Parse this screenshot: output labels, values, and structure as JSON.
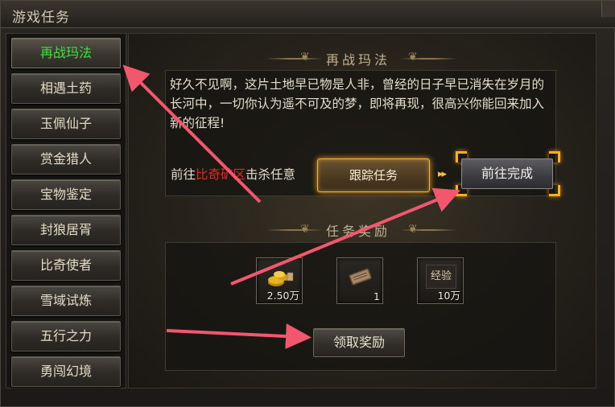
{
  "window": {
    "title": "游戏任务"
  },
  "sidebar": {
    "items": [
      {
        "label": "再战玛法",
        "active": true
      },
      {
        "label": "相遇土药"
      },
      {
        "label": "玉佩仙子"
      },
      {
        "label": "赏金猎人"
      },
      {
        "label": "宝物鉴定"
      },
      {
        "label": "封狼居胥"
      },
      {
        "label": "比奇使者"
      },
      {
        "label": "雪域试炼"
      },
      {
        "label": "五行之力"
      },
      {
        "label": "勇闯幻境"
      }
    ]
  },
  "quest": {
    "title": "再战玛法",
    "description": "好久不见啊，这片土地早已物是人非，曾经的日子早已消失在岁月的长河中，一切你认为遥不可及的梦，即将再现，很高兴你能回来加入新的征程!",
    "goal_prefix": "前往",
    "goal_location": "比奇矿区",
    "goal_suffix": "击杀任意",
    "track_button": "跟踪任务",
    "finish_button": "前往完成"
  },
  "rewards": {
    "title": "任务奖励",
    "items": [
      {
        "icon": "gold-coins-icon",
        "qty": "2.50万"
      },
      {
        "icon": "scroll-book-icon",
        "qty": "1"
      },
      {
        "icon": "experience-icon",
        "qty": "10万",
        "label": "经验"
      }
    ],
    "claim_button": "领取奖励"
  },
  "colors": {
    "active_tab": "#37e63a",
    "location_highlight": "#e5291d",
    "glow": "#ffae21",
    "annotation_arrow": "#f2576e"
  }
}
